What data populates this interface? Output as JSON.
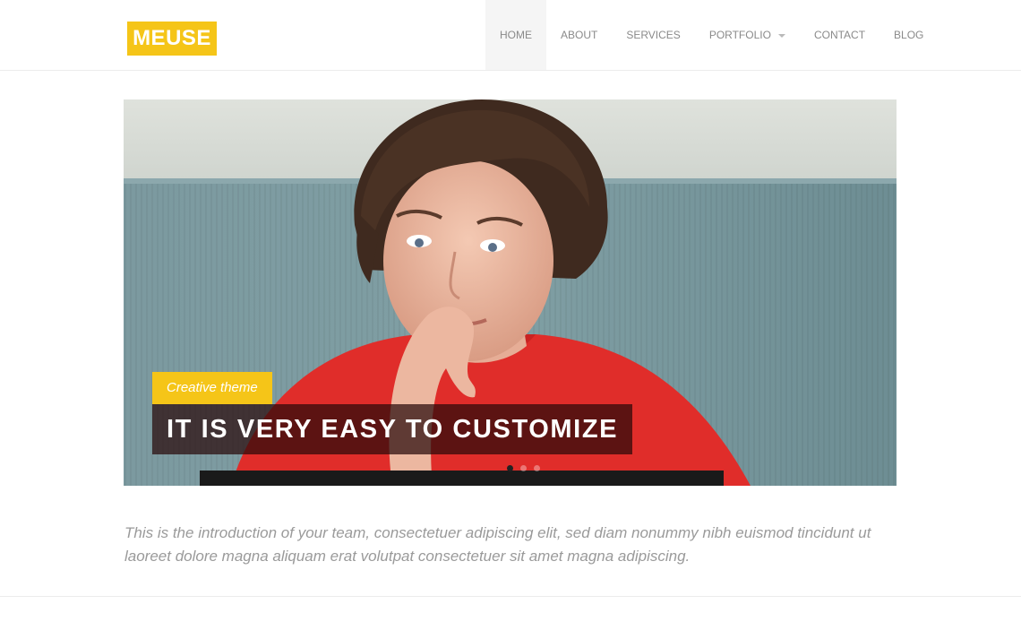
{
  "brand": {
    "logo_text": "MEUSE",
    "accent_color": "#f5c518"
  },
  "nav": {
    "items": [
      {
        "label": "HOME",
        "active": true
      },
      {
        "label": "ABOUT"
      },
      {
        "label": "SERVICES"
      },
      {
        "label": "PORTFOLIO",
        "dropdown": true
      },
      {
        "label": "CONTACT"
      },
      {
        "label": "BLOG"
      }
    ]
  },
  "hero": {
    "tag": "Creative theme",
    "headline": "IT IS VERY EASY TO CUSTOMIZE",
    "slide_count": 3,
    "active_slide": 1
  },
  "intro": {
    "text": "This is the introduction of your team, consectetuer adipiscing elit, sed diam nonummy nibh euismod tincidunt ut laoreet dolore magna aliquam erat volutpat consectetuer sit amet magna adipiscing."
  }
}
